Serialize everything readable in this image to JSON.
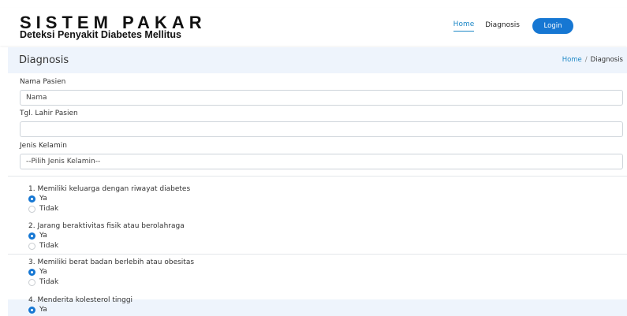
{
  "header": {
    "title": "SISTEM PAKAR",
    "subtitle": "Deteksi Penyakit Diabetes Mellitus",
    "nav": {
      "home": "Home",
      "diagnosis": "Diagnosis",
      "login": "Login"
    }
  },
  "page": {
    "title": "Diagnosis",
    "breadcrumb": {
      "home": "Home",
      "separator": "/",
      "current": "Diagnosis"
    }
  },
  "form": {
    "nama_label": "Nama Pasien",
    "nama_placeholder": "Nama",
    "tgl_label": "Tgl. Lahir Pasien",
    "tgl_value": "",
    "jk_label": "Jenis Kelamin",
    "jk_selected": "--Pilih Jenis Kelamin--"
  },
  "questions": [
    {
      "text": "1. Memiliki keluarga dengan riwayat diabetes",
      "options": [
        "Ya",
        "Tidak"
      ],
      "selected": "Ya"
    },
    {
      "text": "2. Jarang beraktivitas fisik atau berolahraga",
      "options": [
        "Ya",
        "Tidak"
      ],
      "selected": "Ya"
    },
    {
      "text": "3. Memiliki berat badan berlebih atau obesitas",
      "options": [
        "Ya",
        "Tidak"
      ],
      "selected": "Ya"
    },
    {
      "text": "4. Menderita kolesterol tinggi",
      "options": [
        "Ya"
      ],
      "selected": "Ya"
    }
  ],
  "colors": {
    "accent": "#1677d3",
    "link": "#1e88c7",
    "band": "#eef4fc"
  }
}
